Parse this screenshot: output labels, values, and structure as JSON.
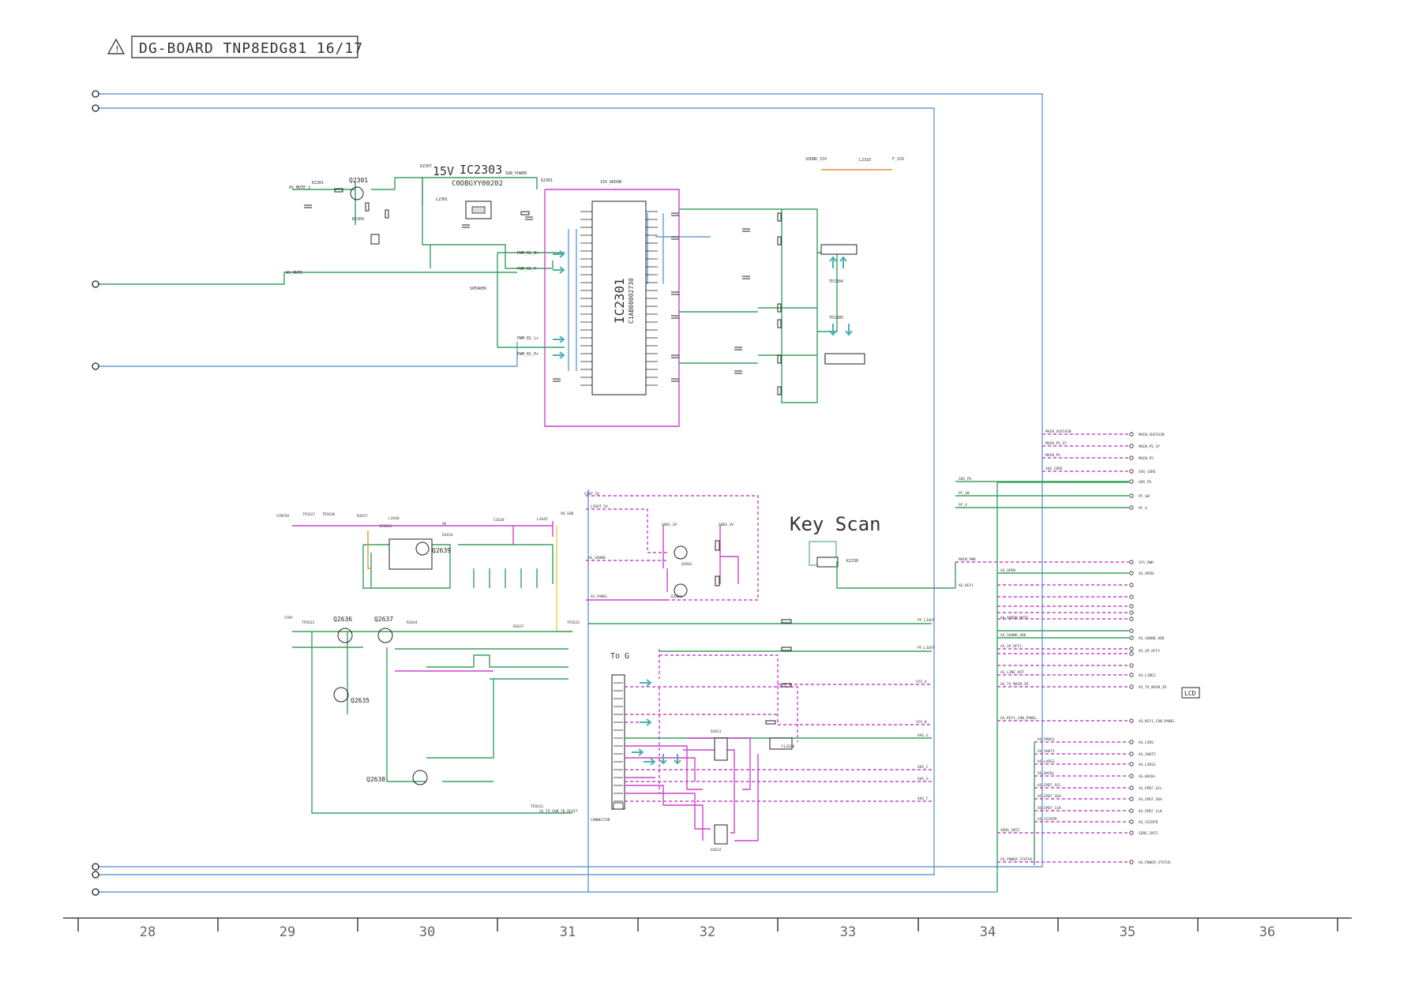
{
  "title": {
    "warning_symbol": "warning-triangle",
    "board": "DG-BOARD TNP8EDG81 16/17"
  },
  "ic2303": {
    "voltage": "15V",
    "name": "IC2303",
    "part": "C0DBGYY00202"
  },
  "ic2301": {
    "name": "IC2301",
    "part": "C1AB00002730"
  },
  "key_scan": "Key Scan",
  "to_g": "To G",
  "lcd": "LCD",
  "transistors": [
    "Q2301",
    "Q2636",
    "Q2637",
    "Q2635",
    "Q2639",
    "Q2638"
  ],
  "grid_columns": [
    "28",
    "29",
    "30",
    "31",
    "32",
    "33",
    "34",
    "35",
    "36"
  ],
  "colors": {
    "bus": "#6a9bd8",
    "signal": "#3aa060",
    "power": "#cc44cc",
    "arrow": "#4ab0b0"
  }
}
